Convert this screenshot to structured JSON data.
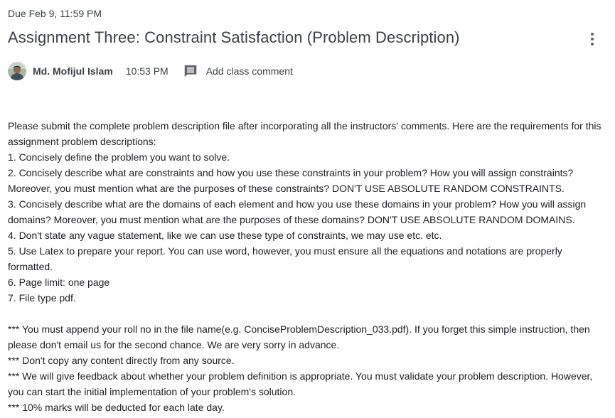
{
  "due": "Due Feb 9, 11:59 PM",
  "title": "Assignment Three: Constraint Satisfaction (Problem Description)",
  "author": {
    "name": "Md. Mofijul Islam",
    "time": "10:53 PM"
  },
  "comment": {
    "label": "Add class comment"
  },
  "icons": {
    "more": "more-vert-icon",
    "comment": "comment-icon",
    "avatar": "avatar-image"
  },
  "description": {
    "intro": "Please submit the complete problem description file after incorporating all the instructors' comments. Here are the requirements for this assignment problem descriptions:",
    "items": [
      "1. Concisely define the problem you want to solve.",
      "2. Concisely describe what are constraints and how you use these constraints in your problem? How you will assign constraints? Moreover, you must mention what are the purposes of these constraints? DON'T USE ABSOLUTE RANDOM CONSTRAINTS.",
      "3. Concisely describe what are the domains of each element and how you use these domains in your problem? How you will assign domains? Moreover, you must mention what are the purposes of these domains? DON'T USE ABSOLUTE RANDOM DOMAINS.",
      "4. Don't state any vague statement, like we can use these type of constraints, we may use etc. etc.",
      "5. Use Latex to prepare your report. You can use word, however, you must ensure all the equations and notations are properly formatted.",
      "6. Page limit: one page",
      "7. File type pdf."
    ],
    "notes": [
      "*** You must append your roll no in the file name(e.g. ConciseProblemDescription_033.pdf). If you forget this simple instruction, then please don't email us for the second chance. We are very sorry in advance.",
      "*** Don't copy any content directly from any source.",
      "*** We will give feedback about whether your problem definition is appropriate. You must validate your problem description. However, you can start the initial implementation of your problem's solution.",
      "*** 10% marks will be deducted for each late day."
    ]
  },
  "colors": {
    "text": "#202124",
    "secondary_text": "#3c4043",
    "icon": "#5f6368"
  }
}
